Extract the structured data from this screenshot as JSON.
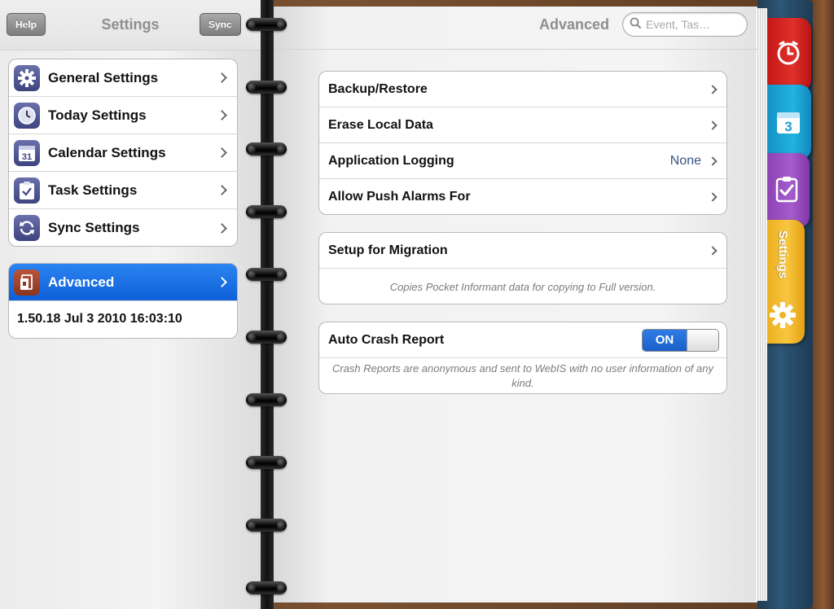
{
  "left_header": {
    "help_label": "Help",
    "title": "Settings",
    "sync_label": "Sync"
  },
  "settings_list": [
    {
      "label": "General Settings",
      "icon": "gear-icon"
    },
    {
      "label": "Today Settings",
      "icon": "clock-icon"
    },
    {
      "label": "Calendar Settings",
      "icon": "calendar-icon"
    },
    {
      "label": "Task Settings",
      "icon": "task-checklist-icon"
    },
    {
      "label": "Sync Settings",
      "icon": "sync-icon"
    }
  ],
  "advanced": {
    "label": "Advanced",
    "icon": "advanced-icon",
    "version": "1.50.18 Jul  3 2010 16:03:10"
  },
  "right_header": {
    "title": "Advanced",
    "search_placeholder": "Event, Tas…"
  },
  "advanced_group": [
    {
      "label": "Backup/Restore",
      "value": ""
    },
    {
      "label": "Erase Local Data",
      "value": ""
    },
    {
      "label": "Application Logging",
      "value": "None"
    },
    {
      "label": "Allow Push Alarms For",
      "value": ""
    }
  ],
  "migration": {
    "label": "Setup for Migration",
    "note": "Copies Pocket Informant data for copying to Full version."
  },
  "crash": {
    "label": "Auto Crash Report",
    "toggle_label": "ON",
    "note": "Crash Reports are anonymous and sent to WebIS with no user information of any kind."
  },
  "tabs": {
    "settings_label": "Settings",
    "calendar_day": "3"
  },
  "colors": {
    "tab_today": "#d8201f",
    "tab_calendar": "#1aa6d8",
    "tab_tasks": "#9b4fc0",
    "tab_settings": "#f0b520",
    "selection": "#1a6ee0",
    "value_text": "#385487"
  }
}
